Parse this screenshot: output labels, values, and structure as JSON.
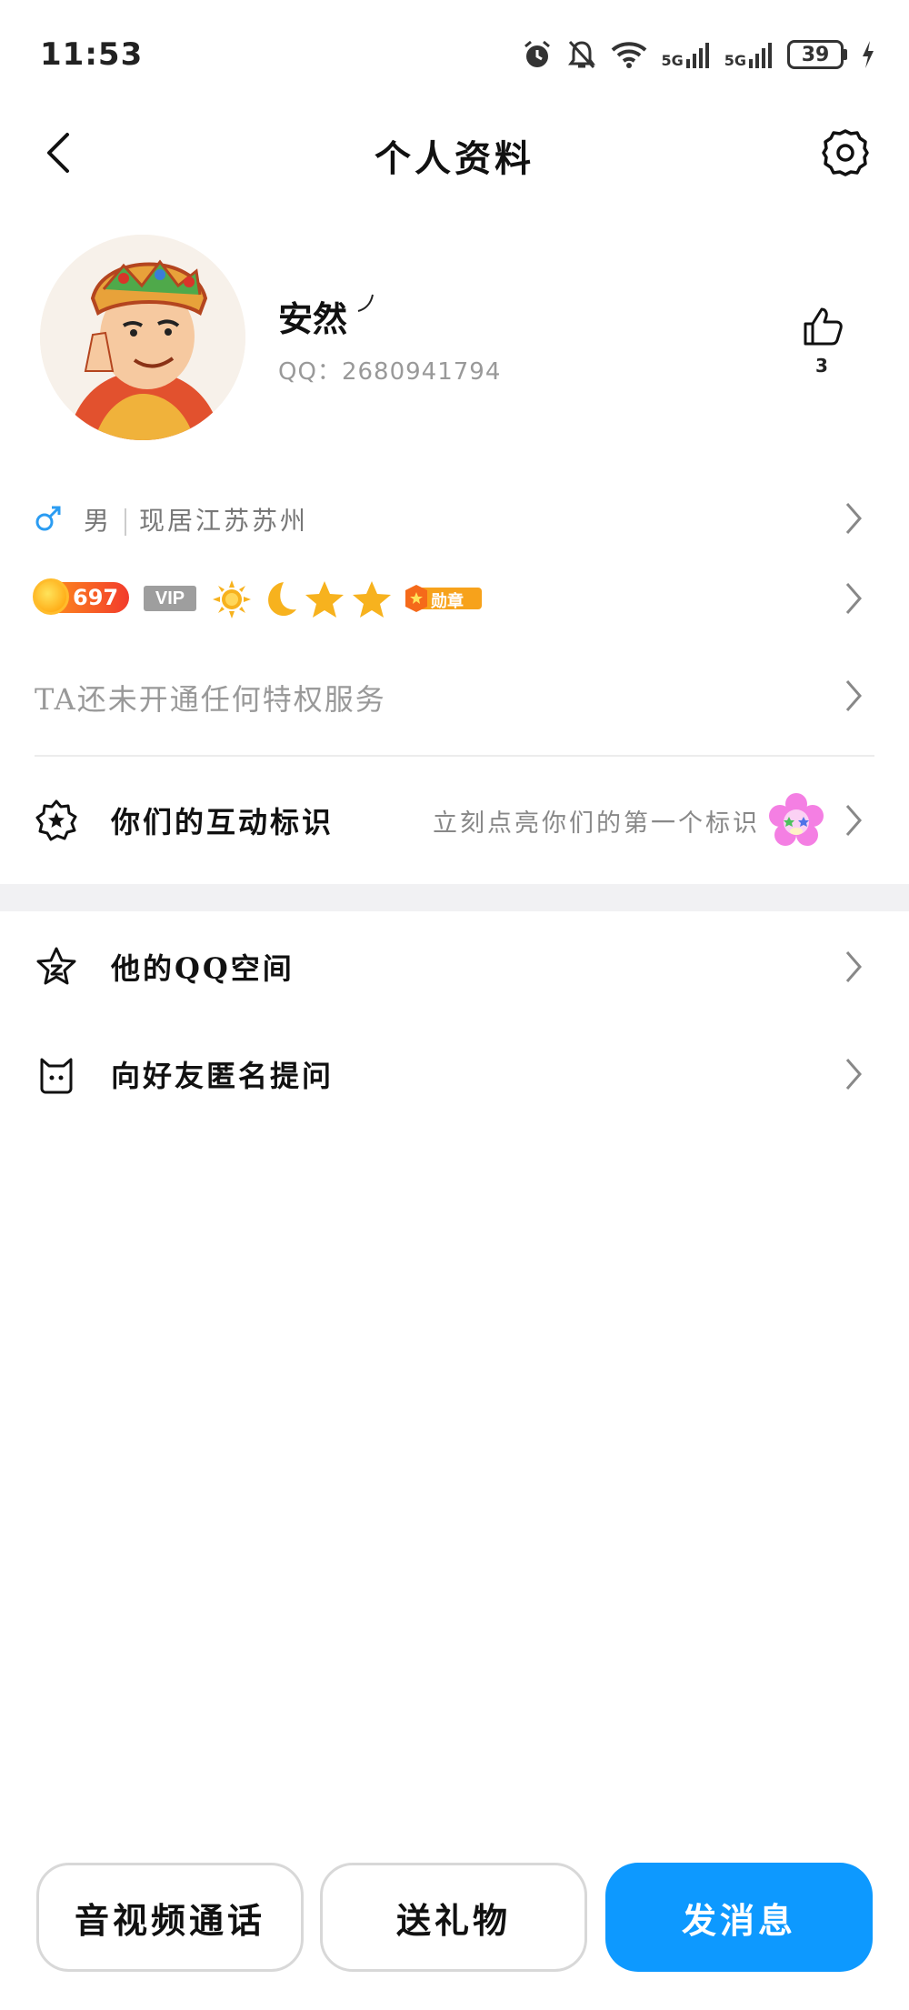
{
  "status": {
    "time": "11:53",
    "net1": "5G",
    "net2": "5G",
    "battery": "39"
  },
  "header": {
    "title": "个人资料"
  },
  "profile": {
    "nickname": "安然",
    "qq_label": "QQ：",
    "qq_number": "2680941794",
    "like_count": "3"
  },
  "info": {
    "gender": "男",
    "location": "现居江苏苏州"
  },
  "badges": {
    "level": "697",
    "vip": "VIP",
    "medal": "勋章"
  },
  "privilege": {
    "text": "TA还未开通任何特权服务"
  },
  "interaction": {
    "label": "你们的互动标识",
    "hint": "立刻点亮你们的第一个标识"
  },
  "menu": {
    "qzone": "他的QQ空间",
    "ask": "向好友匿名提问"
  },
  "actions": {
    "call": "音视频通话",
    "gift": "送礼物",
    "message": "发消息"
  },
  "colors": {
    "primary": "#0d99ff",
    "male": "#2b9cf2",
    "level_badge": "#f23b2c"
  }
}
